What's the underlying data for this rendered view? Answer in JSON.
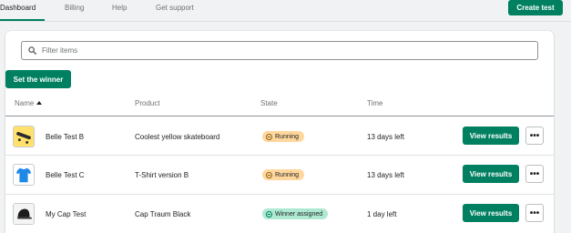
{
  "nav": {
    "tabs": [
      {
        "label": "Dashboard"
      },
      {
        "label": "Billing"
      },
      {
        "label": "Help"
      },
      {
        "label": "Get support"
      }
    ],
    "create_label": "Create test"
  },
  "filter": {
    "placeholder": "Filter items",
    "value": ""
  },
  "set_winner_label": "Set the winner",
  "table": {
    "headers": {
      "name": "Name",
      "product": "Product",
      "state": "State",
      "time": "Time"
    },
    "rows": [
      {
        "name": "Belle Test B",
        "product": "Coolest yellow skateboard",
        "state": "Running",
        "time": "13 days left",
        "action": "View results",
        "more": "•••",
        "thumb": "skateboard-icon"
      },
      {
        "name": "Belle Test C",
        "product": "T-Shirt version B",
        "state": "Running",
        "time": "13 days left",
        "action": "View results",
        "more": "•••",
        "thumb": "tshirt-icon"
      },
      {
        "name": "My Cap Test",
        "product": "Cap Traum Black",
        "state": "Winner assigned",
        "time": "1 day left",
        "action": "View results",
        "more": "•••",
        "thumb": "cap-icon"
      }
    ]
  },
  "colors": {
    "accent": "#008060",
    "running_badge": "#ffd79d",
    "winner_badge": "#aee9d1"
  }
}
